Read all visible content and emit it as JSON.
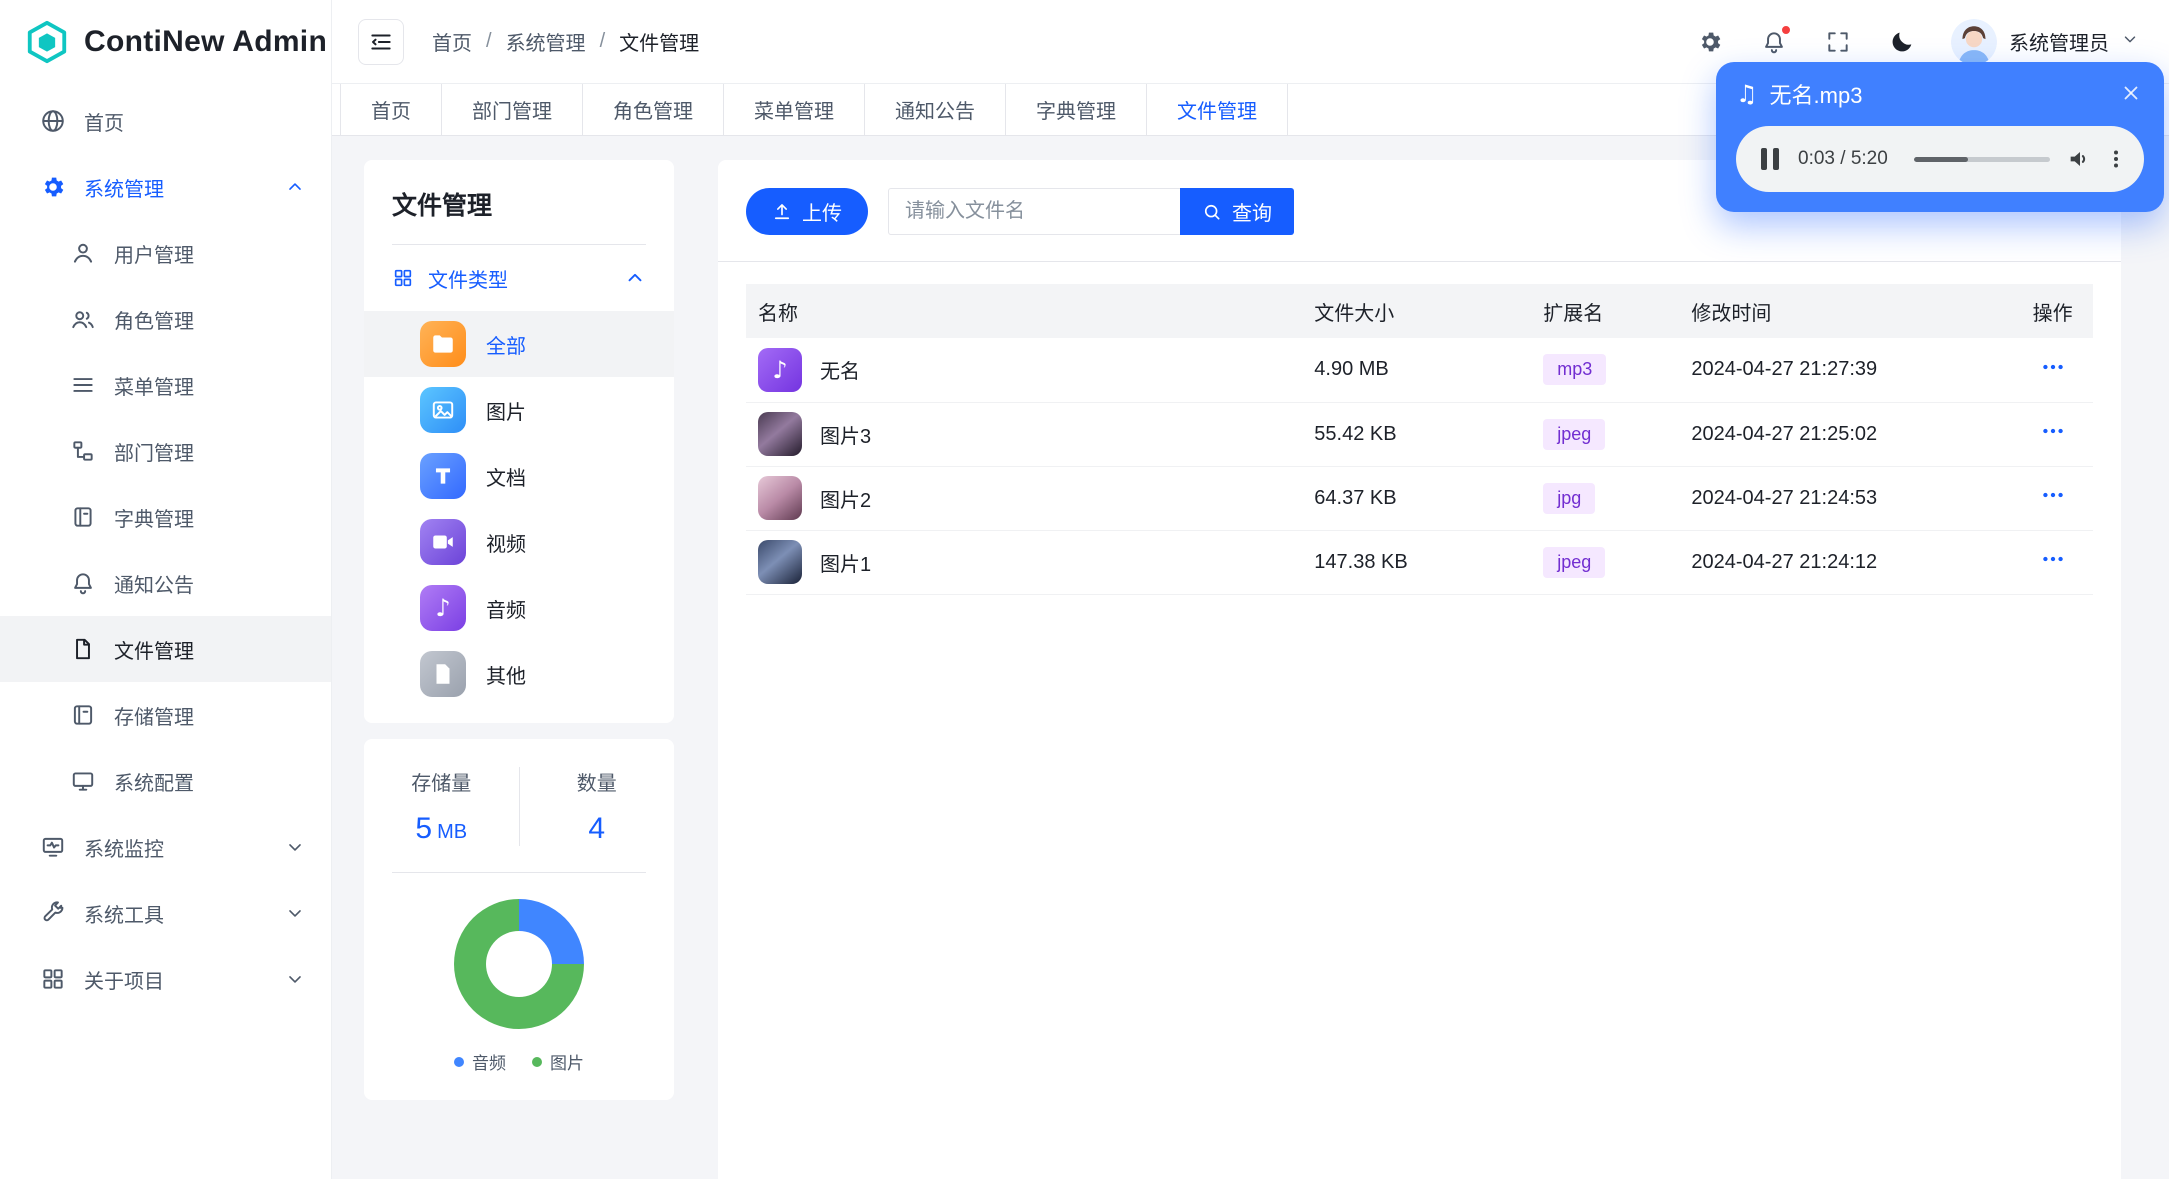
{
  "app": {
    "title": "ContiNew Admin"
  },
  "header": {
    "breadcrumb": [
      "首页",
      "系统管理",
      "文件管理"
    ],
    "separator": "/",
    "username": "系统管理员"
  },
  "tabs": {
    "items": [
      "首页",
      "部门管理",
      "角色管理",
      "菜单管理",
      "通知公告",
      "字典管理",
      "文件管理"
    ],
    "active": "文件管理"
  },
  "sidebar": {
    "items": [
      {
        "label": "首页"
      },
      {
        "label": "系统管理",
        "expanded": true
      },
      {
        "label": "用户管理"
      },
      {
        "label": "角色管理"
      },
      {
        "label": "菜单管理"
      },
      {
        "label": "部门管理"
      },
      {
        "label": "字典管理"
      },
      {
        "label": "通知公告"
      },
      {
        "label": "文件管理",
        "active": true
      },
      {
        "label": "存储管理"
      },
      {
        "label": "系统配置"
      },
      {
        "label": "系统监控"
      },
      {
        "label": "系统工具"
      },
      {
        "label": "关于项目"
      }
    ]
  },
  "player": {
    "title": "无名.mp3",
    "time": "0:03 / 5:20"
  },
  "filePanel": {
    "title": "文件管理",
    "typeGroup": "文件类型",
    "types": [
      {
        "label": "全部",
        "active": true
      },
      {
        "label": "图片"
      },
      {
        "label": "文档"
      },
      {
        "label": "视频"
      },
      {
        "label": "音频"
      },
      {
        "label": "其他"
      }
    ],
    "stats": {
      "storageLabel": "存储量",
      "storageValue": "5",
      "storageUnit": "MB",
      "countLabel": "数量",
      "countValue": "4"
    }
  },
  "chart_data": {
    "type": "pie",
    "subtype": "donut",
    "legend_position": "bottom",
    "series": [
      {
        "name": "音频",
        "value": 1,
        "color": "#4086FF"
      },
      {
        "name": "图片",
        "value": 3,
        "color": "#57B85C"
      }
    ]
  },
  "toolbar": {
    "upload": "上传",
    "search_placeholder": "请输入文件名",
    "query": "查询"
  },
  "table": {
    "headers": [
      "名称",
      "文件大小",
      "扩展名",
      "修改时间",
      "操作"
    ],
    "rows": [
      {
        "name": "无名",
        "size": "4.90 MB",
        "ext": "mp3",
        "time": "2024-04-27 21:27:39"
      },
      {
        "name": "图片3",
        "size": "55.42 KB",
        "ext": "jpeg",
        "time": "2024-04-27 21:25:02"
      },
      {
        "name": "图片2",
        "size": "64.37 KB",
        "ext": "jpg",
        "time": "2024-04-27 21:24:53"
      },
      {
        "name": "图片1",
        "size": "147.38 KB",
        "ext": "jpeg",
        "time": "2024-04-27 21:24:12"
      }
    ]
  },
  "colors": {
    "primary": "#165DFF",
    "player_bg": "#4080FF",
    "badge_bg": "#F5E8FF",
    "badge_text": "#722ED1",
    "notification_dot": "#F53F3F"
  }
}
